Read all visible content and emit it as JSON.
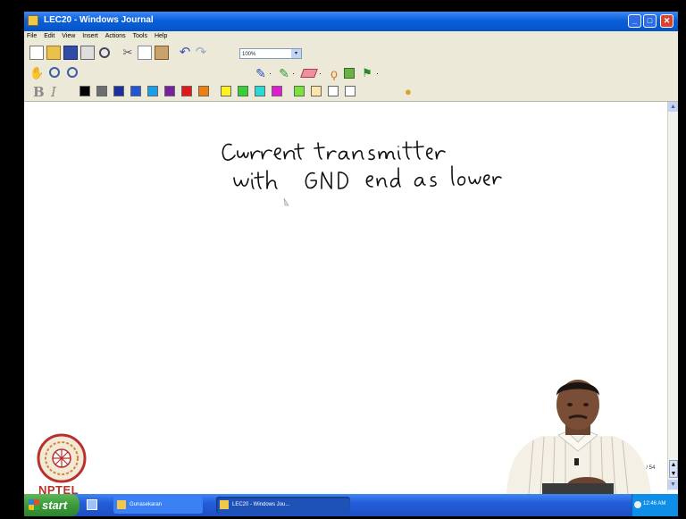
{
  "window": {
    "title": "LEC20 - Windows Journal",
    "controls": {
      "minimize": "_",
      "maximize": "□",
      "close": "✕"
    }
  },
  "menu": [
    "File",
    "Edit",
    "View",
    "Insert",
    "Actions",
    "Tools",
    "Help"
  ],
  "toolbar": {
    "zoom_value": "100%",
    "zoom_arrow": "▾",
    "format_bold": "B",
    "format_italic": "I"
  },
  "colors": {
    "palette": [
      "#000000",
      "#6e6e6e",
      "#1c2f9e",
      "#2256d8",
      "#1aa0e6",
      "#7b1fa2",
      "#e3171a",
      "#f07f0a",
      "#fff11e",
      "#33d233",
      "#29d9d9",
      "#e21bd1",
      "#7ae33a",
      "#fbe6a6",
      "#ffffff",
      "#ffffff"
    ]
  },
  "canvas": {
    "handwriting_line1": "current transmitter",
    "handwriting_line2": "with GND end as lower"
  },
  "page_indicator": "54 / 54",
  "logo_text": "NPTEL",
  "taskbar": {
    "start_label": "start",
    "tasks": [
      "Gunasekaran",
      "LEC20 - Windows Jou..."
    ],
    "clock": "12:46 AM"
  }
}
